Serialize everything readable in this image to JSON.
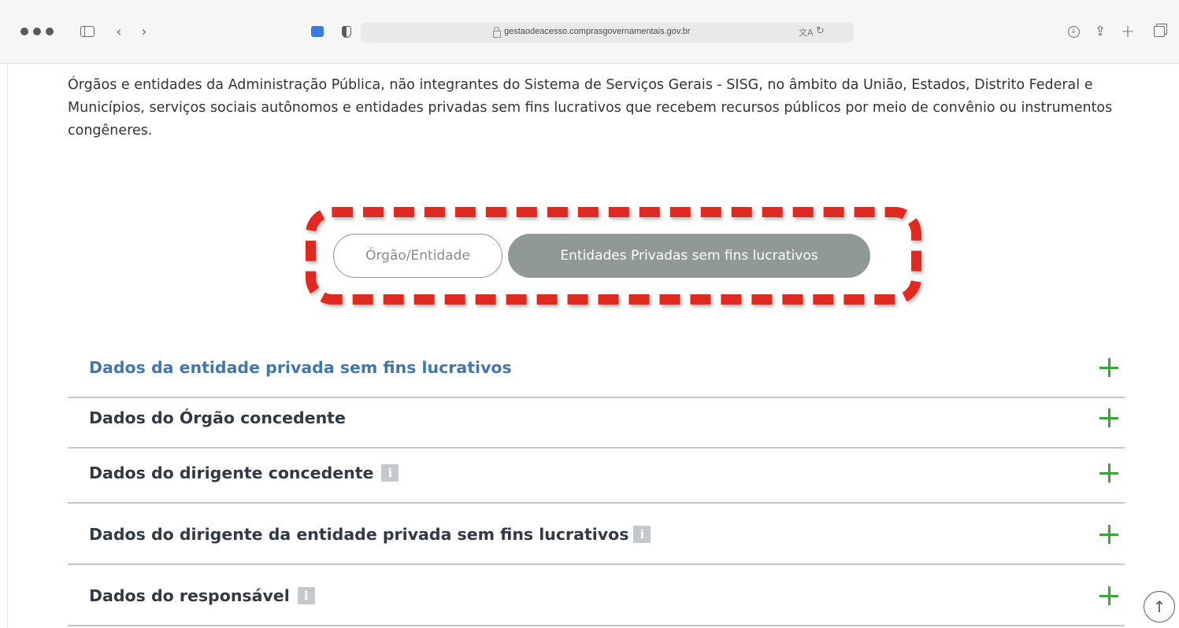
{
  "browser": {
    "url": "gestaodeacesso.comprasgovernamentais.gov.br",
    "back_icon": "‹",
    "forward_icon": "›",
    "share_icon": "⇪",
    "newtab_icon": "+",
    "translate_icon": "文A",
    "reload_icon": "↻",
    "download_icon": "↓"
  },
  "intro_text": "Órgãos e entidades da Administração Pública, não integrantes do Sistema de Serviços Gerais - SISG, no âmbito da União, Estados, Distrito Federal e Municípios, serviços sociais autônomos e entidades privadas sem fins lucrativos que recebem recursos públicos por meio de convênio ou instrumentos congêneres.",
  "toggle": {
    "option_1": "Órgão/Entidade",
    "option_2": "Entidades Privadas sem fins lucrativos",
    "selected": "Entidades Privadas sem fins lucrativos"
  },
  "accordion": [
    {
      "title": "Dados da entidade privada sem fins lucrativos",
      "active": true,
      "info": false
    },
    {
      "title": "Dados do Órgão concedente",
      "active": false,
      "info": false
    },
    {
      "title": "Dados do dirigente concedente",
      "active": false,
      "info": true
    },
    {
      "title": "Dados do dirigente da entidade privada sem fins lucrativos",
      "active": false,
      "info": true
    },
    {
      "title": "Dados do responsável",
      "active": false,
      "info": true
    }
  ],
  "info_icon_glyph": "i",
  "scroll_top_glyph": "↑",
  "colors": {
    "annotation": "#df2a22",
    "active_title": "#3f77ae",
    "plus": "#3aa63a",
    "toggle_selected_bg": "#8f9a97"
  }
}
